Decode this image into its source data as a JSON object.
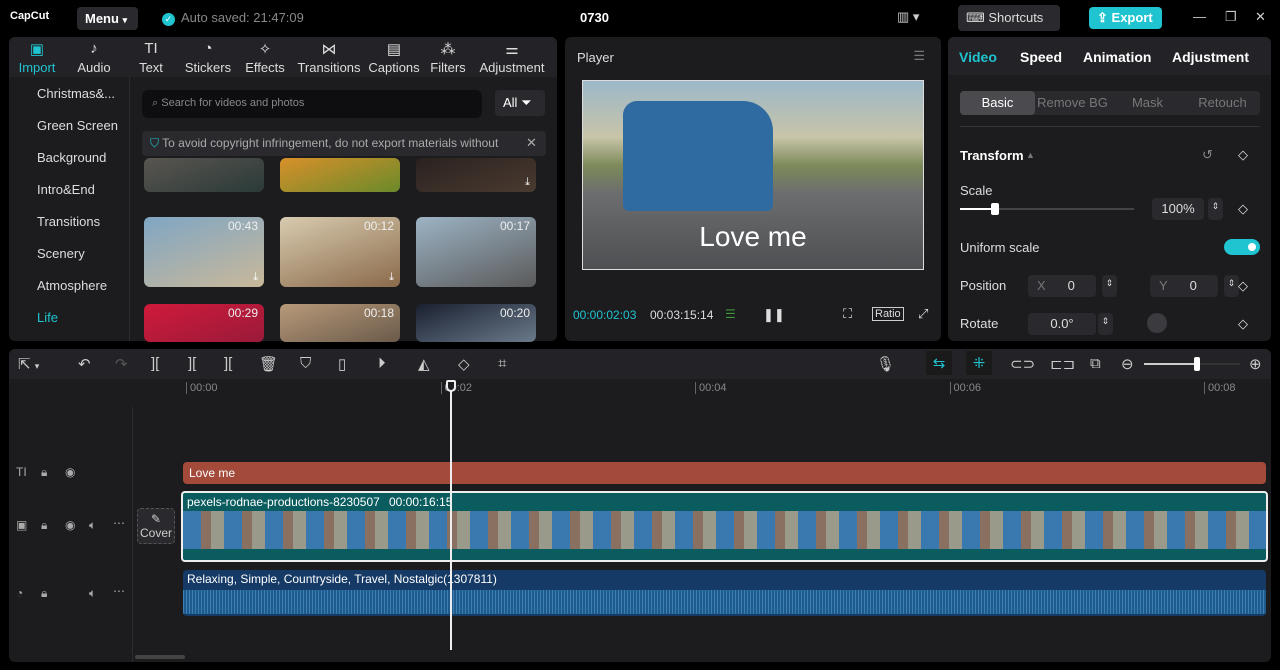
{
  "app": {
    "logo": "CapCut",
    "menu": "Menu",
    "auto_saved": "Auto saved: 21:47:09",
    "project": "0730",
    "shortcuts": "Shortcuts",
    "export": "Export"
  },
  "media_tabs": [
    {
      "label": "Import",
      "icon": "▣"
    },
    {
      "label": "Audio",
      "icon": "♪"
    },
    {
      "label": "Text",
      "icon": "TI"
    },
    {
      "label": "Stickers",
      "icon": "◔"
    },
    {
      "label": "Effects",
      "icon": "✧"
    },
    {
      "label": "Transitions",
      "icon": "⋈"
    },
    {
      "label": "Captions",
      "icon": "▤"
    },
    {
      "label": "Filters",
      "icon": "⁂"
    },
    {
      "label": "Adjustment",
      "icon": "⚌"
    }
  ],
  "categories": [
    "Christmas&...",
    "Green Screen",
    "Background",
    "Intro&End",
    "Transitions",
    "Scenery",
    "Atmosphere",
    "Life"
  ],
  "search": {
    "placeholder": "Search for videos and photos",
    "filter": "All"
  },
  "notice": "To avoid copyright infringement, do not export materials without",
  "thumbs": [
    {
      "dur": ""
    },
    {
      "dur": ""
    },
    {
      "dur": ""
    },
    {
      "dur": "00:43"
    },
    {
      "dur": "00:12"
    },
    {
      "dur": "00:17"
    },
    {
      "dur": "00:29"
    },
    {
      "dur": "00:18"
    },
    {
      "dur": "00:20"
    }
  ],
  "player": {
    "title": "Player",
    "caption": "Love me",
    "current": "00:00:02:03",
    "total": "00:03:15:14",
    "ratio": "Ratio"
  },
  "inspector": {
    "tabs": [
      "Video",
      "Speed",
      "Animation",
      "Adjustment"
    ],
    "subtabs": [
      "Basic",
      "Remove BG",
      "Mask",
      "Retouch"
    ],
    "section": "Transform",
    "scale_label": "Scale",
    "scale": "100%",
    "scale_fraction": 0.2,
    "uniform": "Uniform scale",
    "uniform_on": true,
    "position_label": "Position",
    "x_label": "X",
    "x": "0",
    "y_label": "Y",
    "y": "0",
    "rotate_label": "Rotate",
    "rotate": "0.0°"
  },
  "timeline": {
    "ticks": [
      "00:00",
      "00:02",
      "00:04",
      "00:06",
      "00:08"
    ],
    "text_clip": "Love me",
    "video_clip": "pexels-rodnae-productions-8230507",
    "video_dur": "00:00:16:15",
    "cover": "Cover",
    "audio_clip": "Relaxing, Simple, Countryside, Travel, Nostalgic(1307811)",
    "zoom_fraction": 0.55
  },
  "colors": {
    "accent": "#1fc4d0",
    "text_clip": "#a34a3a",
    "video_clip": "#0b5c5e",
    "audio_clip": "#163a66"
  }
}
